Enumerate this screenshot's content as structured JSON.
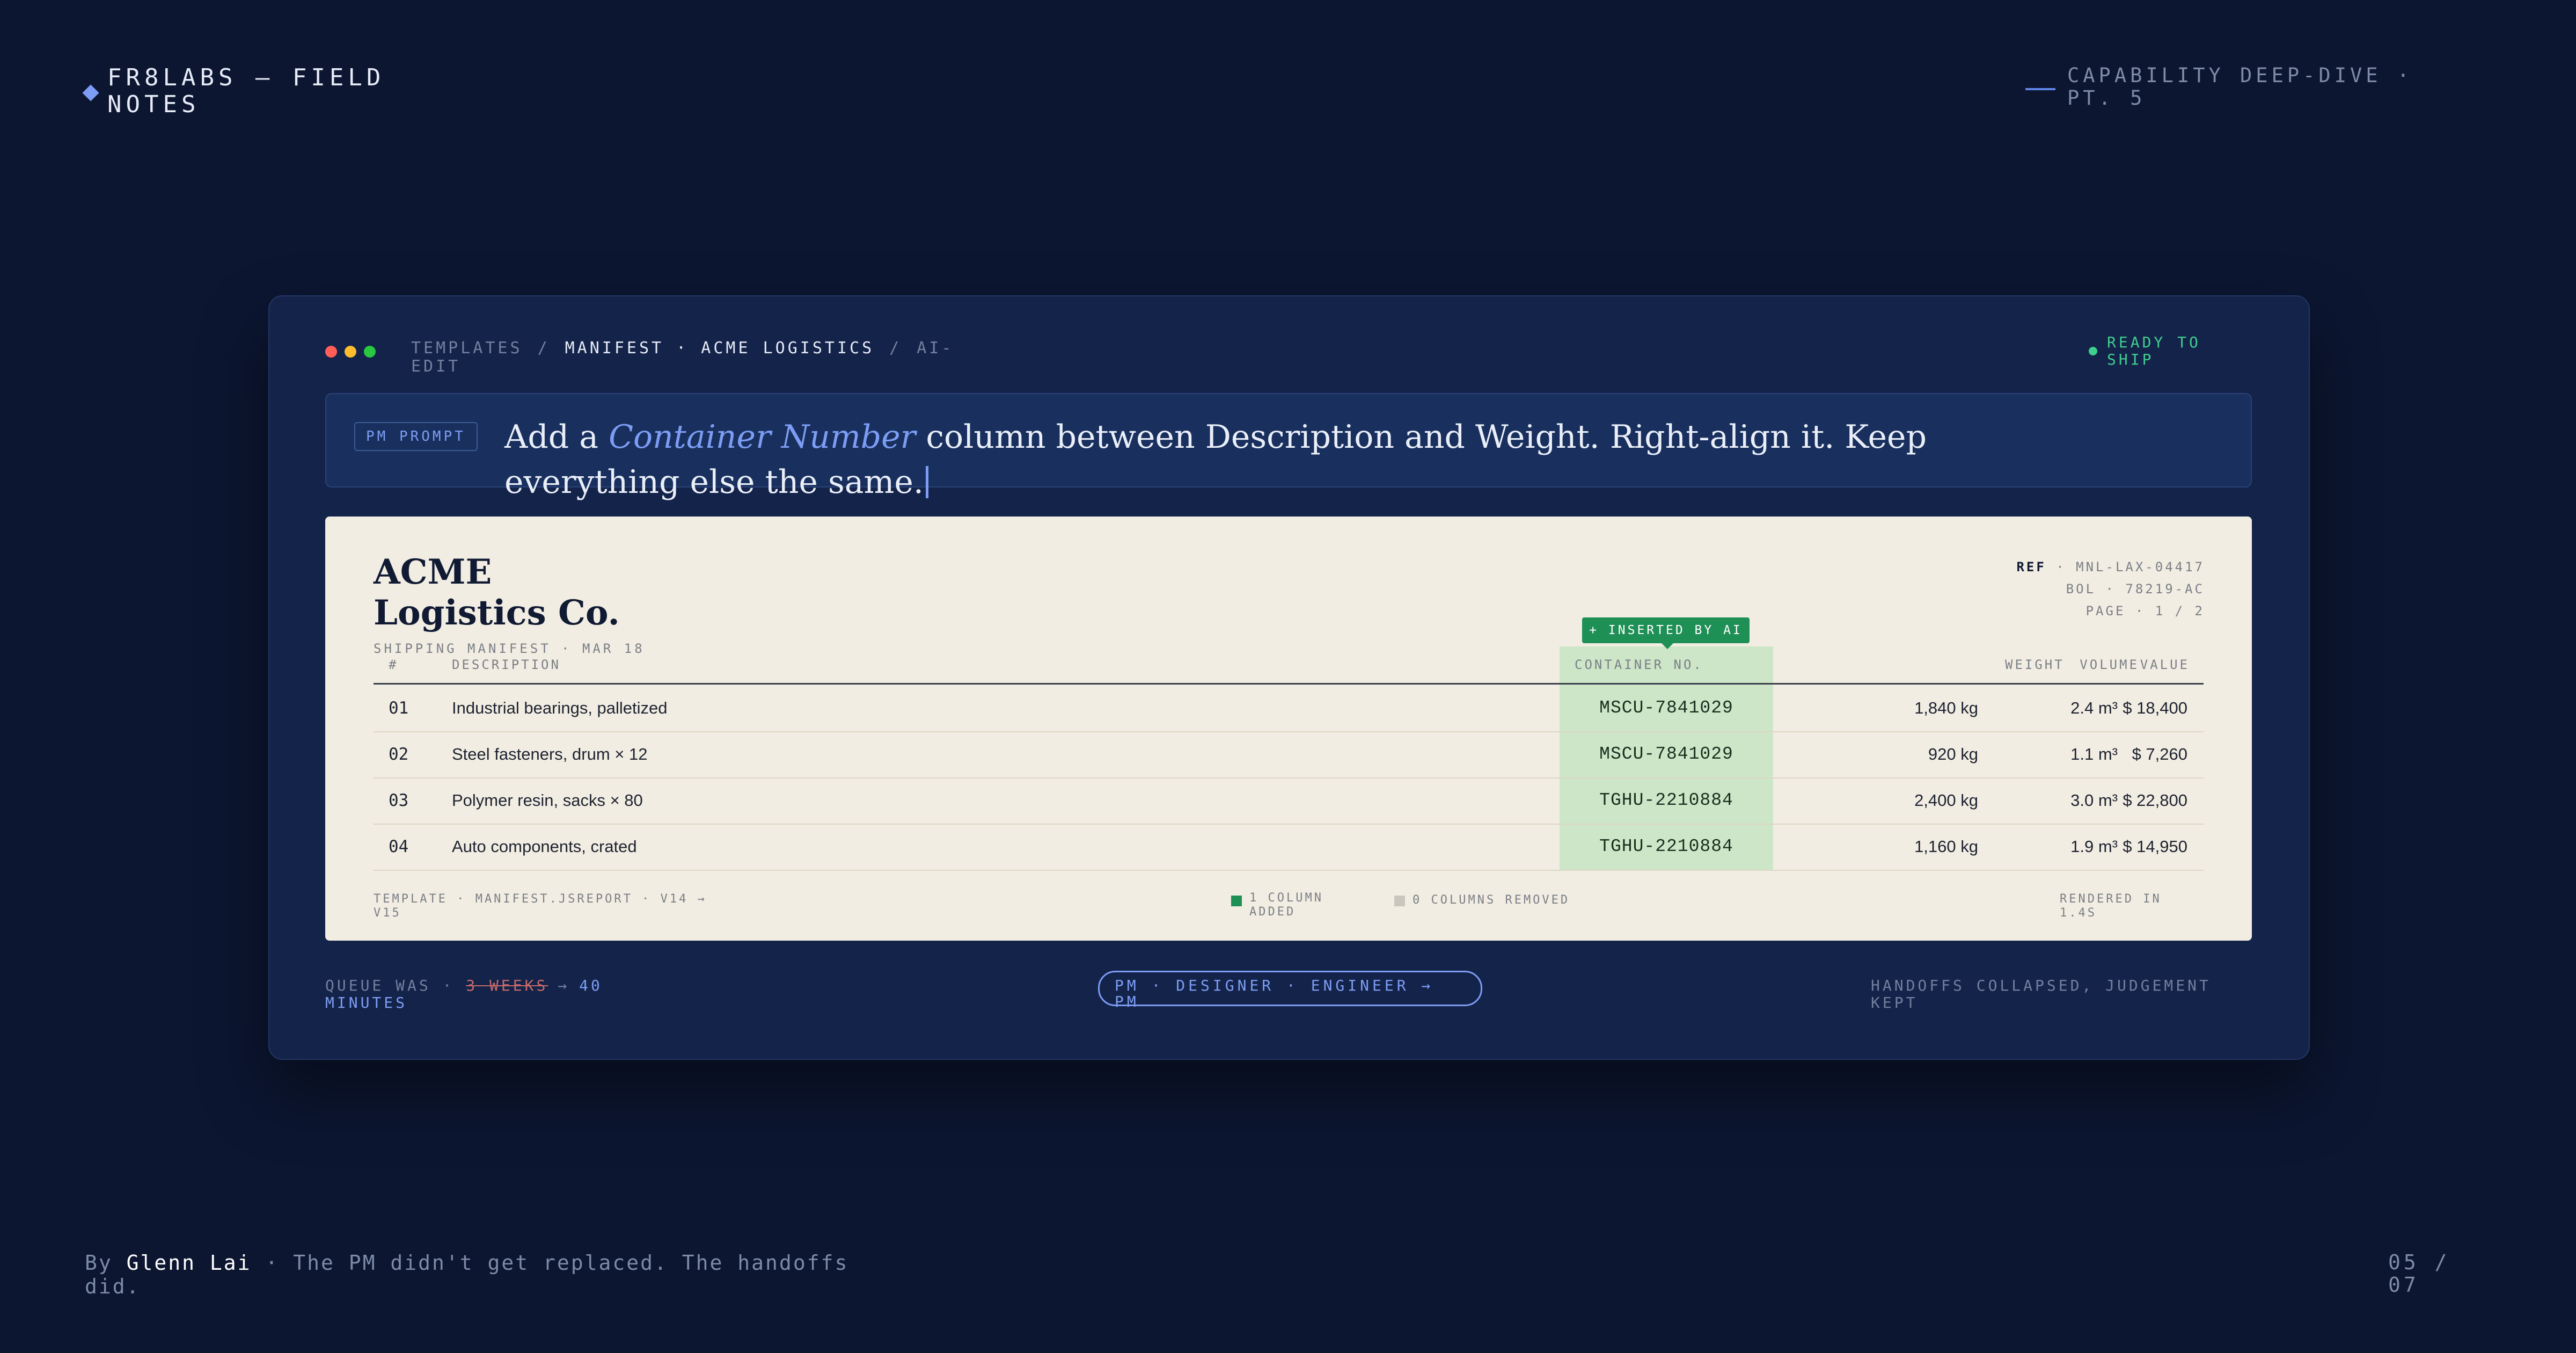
{
  "header": {
    "brand": "FR8LABS — FIELD NOTES",
    "capability": "CAPABILITY DEEP-DIVE · PT. 5"
  },
  "window": {
    "traffic_lights": [
      "#ff5f57",
      "#febc2e",
      "#28c840"
    ],
    "breadcrumb": [
      "TEMPLATES",
      "MANIFEST · ACME LOGISTICS",
      "AI-EDIT"
    ],
    "breadcrumb_separator": "/",
    "status": "READY TO SHIP",
    "status_color": "#3fcf8e"
  },
  "prompt": {
    "tag": "PM PROMPT",
    "text_before": "Add a ",
    "highlight": "Container Number",
    "text_after": " column between Description and Weight. Right-align it. Keep everything else the same."
  },
  "manifest": {
    "company": "ACME Logistics Co.",
    "subtitle": "SHIPPING MANIFEST · MAR 18",
    "ref_label": "REF",
    "ref_value": "· MNL-LAX-04417",
    "bol": "BOL · 78219-AC",
    "page": "PAGE · 1 / 2",
    "ai_badge": "+ INSERTED BY AI",
    "columns": {
      "num": "#",
      "description": "DESCRIPTION",
      "container": "CONTAINER NO.",
      "weight": "WEIGHT",
      "volume": "VOLUME",
      "value": "VALUE"
    },
    "rows": [
      {
        "num": "01",
        "description": "Industrial bearings, palletized",
        "container": "MSCU-7841029",
        "weight": "1,840 kg",
        "volume": "2.4 m³",
        "value": "$ 18,400"
      },
      {
        "num": "02",
        "description": "Steel fasteners, drum × 12",
        "container": "MSCU-7841029",
        "weight": "920 kg",
        "volume": "1.1 m³",
        "value": "$ 7,260"
      },
      {
        "num": "03",
        "description": "Polymer resin, sacks × 80",
        "container": "TGHU-2210884",
        "weight": "2,400 kg",
        "volume": "3.0 m³",
        "value": "$ 22,800"
      },
      {
        "num": "04",
        "description": "Auto components, crated",
        "container": "TGHU-2210884",
        "weight": "1,160 kg",
        "volume": "1.9 m³",
        "value": "$ 14,950"
      }
    ],
    "footer": {
      "template": "TEMPLATE · MANIFEST.JSREPORT · V14 → V15",
      "added": "1 COLUMN ADDED",
      "added_color": "#1e8f55",
      "removed": "0 COLUMNS REMOVED",
      "removed_color": "#c9c6be",
      "rendered": "RENDERED IN 1.4S"
    }
  },
  "strip": {
    "queue_label": "QUEUE WAS ·",
    "queue_old": "3 WEEKS",
    "queue_arrow": "→",
    "queue_new": "40 MINUTES",
    "roles": "PM · DESIGNER · ENGINEER → PM",
    "collapsed": "HANDOFFS COLLAPSED, JUDGEMENT KEPT"
  },
  "footer": {
    "by": "By",
    "author": "Glenn Lai",
    "tagline": "· The PM didn't get replaced. The handoffs did.",
    "page_counter": "05 / 07"
  }
}
